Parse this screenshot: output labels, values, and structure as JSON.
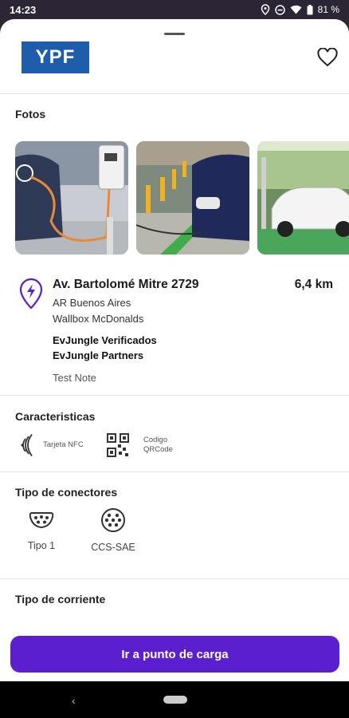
{
  "status_bar": {
    "time": "14:23",
    "battery": "81 %"
  },
  "header": {
    "brand": "YPF"
  },
  "photos": {
    "title": "Fotos"
  },
  "station": {
    "address": "Av. Bartolomé Mitre 2729",
    "distance": "6,4 km",
    "city": "AR Buenos Aires",
    "place": "Wallbox McDonalds",
    "tag_verified": "EvJungle Verificados",
    "tag_partners": "EvJungle Partners",
    "note": "Test Note"
  },
  "features": {
    "title": "Caracteristicas",
    "items": [
      {
        "icon": "nfc-icon",
        "label": "Tarjeta NFC"
      },
      {
        "icon": "qr-code-icon",
        "label_line1": "Codigo",
        "label_line2": "QRCode"
      }
    ]
  },
  "connectors": {
    "title": "Tipo de conectores",
    "items": [
      {
        "icon": "type1-connector-icon",
        "label": "Tipo 1"
      },
      {
        "icon": "ccs-sae-connector-icon",
        "label": "CCS-SAE"
      }
    ]
  },
  "current": {
    "title": "Tipo de corriente"
  },
  "cta": {
    "label": "Ir a punto de carga"
  },
  "colors": {
    "primary": "#5b1fcf",
    "brand_blue": "#1d5dab"
  }
}
